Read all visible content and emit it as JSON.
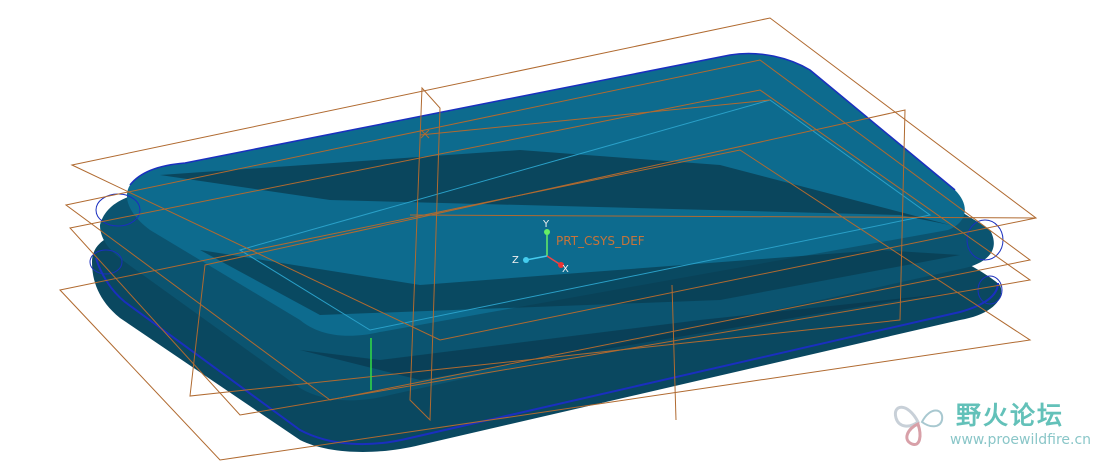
{
  "viewport": {
    "coordinate_system": {
      "name": "PRT_CSYS_DEF",
      "axes": {
        "x": "X",
        "y": "Y",
        "z": "Z"
      }
    }
  },
  "watermark": {
    "title": "野火论坛",
    "url": "www.proewildfire.cn",
    "logo_icon": "butterfly-logo-icon"
  },
  "colors": {
    "model_fill": "#0b6a8c",
    "model_dark": "#0a3d52",
    "datum_plane": "#b06a30",
    "edge_highlight": "#1a2fbf",
    "background": "#ffffff"
  }
}
